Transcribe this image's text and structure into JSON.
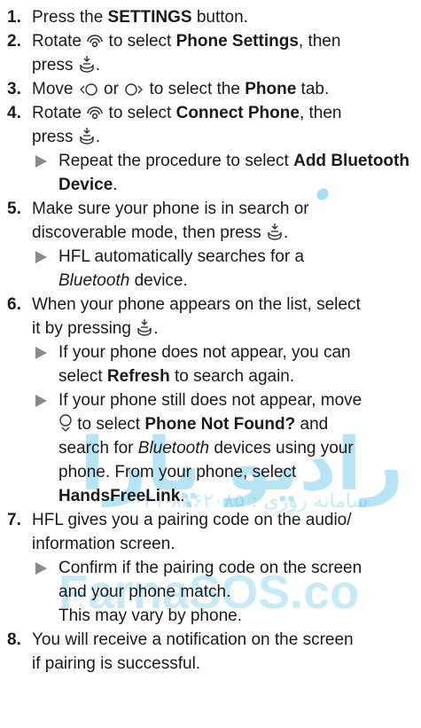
{
  "watermark": {
    "persian": "رادیو پارا",
    "phone": "۰۲۱-۸۸۶۲۰۸۵ : سامانه روزی",
    "latin": "FarnaSOS.co"
  },
  "icons": {
    "rotate": "rotate-knob-icon",
    "press": "press-knob-icon",
    "move_left": "move-left-knob-icon",
    "move_right": "move-right-knob-icon",
    "move_down": "move-down-knob-icon",
    "substep": "triangle-bullet-icon"
  },
  "colors": {
    "text": "#1a1a1a",
    "bullet": "#8a8a8a",
    "watermark": "#00a3e0"
  },
  "steps": [
    {
      "num": "1.",
      "a": "Press the ",
      "b": "SETTINGS",
      "c": " button."
    },
    {
      "num": "2.",
      "a": "Rotate ",
      "b": " to select ",
      "c": "Phone Settings",
      "d": ", then",
      "e": "press ",
      "f": "."
    },
    {
      "num": "3.",
      "a": "Move ",
      "b": " or ",
      "c": " to select the ",
      "d": "Phone",
      "e": " tab."
    },
    {
      "num": "4.",
      "a": "Rotate ",
      "b": " to select ",
      "c": "Connect Phone",
      "d": ", then",
      "e": "press ",
      "f": ".",
      "sub": {
        "a": "Repeat the procedure to select ",
        "b": "Add Bluetooth Device",
        "c": "."
      }
    },
    {
      "num": "5.",
      "a": "Make sure your phone is in search or",
      "b": "discoverable mode, then press ",
      "c": ".",
      "sub": {
        "a": "HFL automatically searches for a",
        "b": "Bluetooth",
        "c": " device."
      }
    },
    {
      "num": "6.",
      "a": "When your phone appears on the list, select",
      "b": "it by pressing ",
      "c": ".",
      "sub1": {
        "a": "If your phone does not appear, you can",
        "b": "select ",
        "c": "Refresh",
        "d": " to search again."
      },
      "sub2": {
        "a": "If your phone still does not appear, move",
        "b": " to select ",
        "c": "Phone Not Found?",
        "d": " and",
        "e": "search for ",
        "f": "Bluetooth",
        "g": " devices using your",
        "h": "phone. From your phone, select",
        "i": "HandsFreeLink",
        "j": "."
      }
    },
    {
      "num": "7.",
      "a": "HFL gives you a pairing code on the audio/",
      "b": "information screen.",
      "sub": {
        "a": "Confirm if the pairing code on the screen",
        "b": "and your phone match.",
        "c": "This may vary by phone."
      }
    },
    {
      "num": "8.",
      "a": "You will receive a notification on the screen",
      "b": "if pairing is successful."
    }
  ]
}
